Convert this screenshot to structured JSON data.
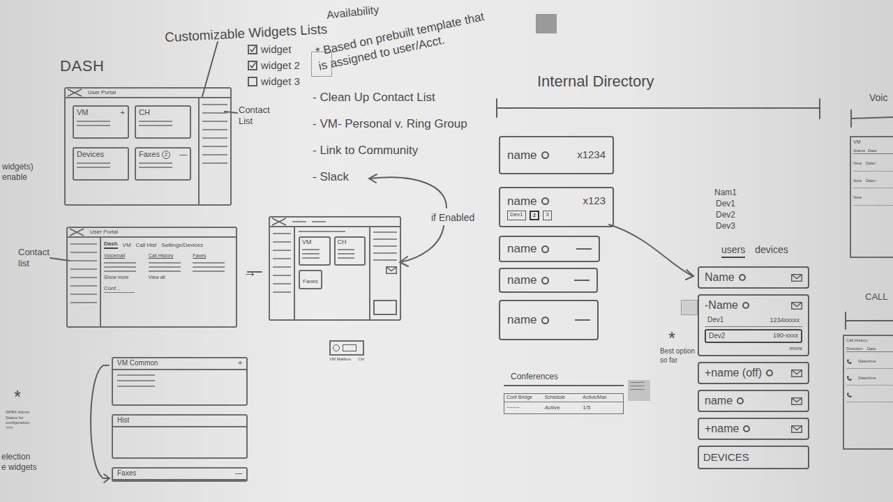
{
  "dash": {
    "title": "DASH",
    "contact_list_label": "Contact List",
    "edge_note": [
      "widgets)",
      "enable"
    ]
  },
  "widget_lists": {
    "title": "Customizable Widgets Lists",
    "items": [
      {
        "label": "widget",
        "checked": true
      },
      {
        "label": "widget 2",
        "checked": true
      },
      {
        "label": "widget 3",
        "checked": false
      }
    ]
  },
  "availability": {
    "title": "Availability",
    "note": "* Based on prebuilt template that is assigned to user/Acct."
  },
  "wireframe_1": {
    "title": "User Portal",
    "widgets": [
      {
        "label": "VM",
        "action": "+"
      },
      {
        "label": "CH"
      },
      {
        "label": "Devices"
      },
      {
        "label": "Faxes",
        "badge": "2",
        "action": "—"
      }
    ]
  },
  "todo": {
    "items": [
      "- Clean Up Contact List",
      "- VM- Personal v. Ring Group",
      "- Link to Community",
      "- Slack"
    ],
    "condition": "if Enabled"
  },
  "wireframe_2": {
    "title": "User Portal",
    "side_label": "Contact list",
    "tabs": [
      {
        "label": "Dash",
        "selected": true
      },
      {
        "label": "VM",
        "selected": false
      },
      {
        "label": "Call Hist",
        "selected": false
      },
      {
        "label": "Settings/Devices",
        "selected": false
      }
    ],
    "columns": [
      {
        "title": "Voicemail",
        "link": "Show more"
      },
      {
        "title": "Call History",
        "link": "View all"
      },
      {
        "title": "Faxes"
      }
    ],
    "footer": "Conf..."
  },
  "arrow": "→",
  "wireframe_3": {
    "widgets": [
      "VM",
      "CH"
    ],
    "footer": "Faxes"
  },
  "mini_widget": {
    "labels": [
      "VM Mailbox",
      "CH"
    ]
  },
  "wireframe_4": {
    "panels": [
      {
        "title": "VM Common",
        "action": "+"
      },
      {
        "title": "Hist"
      },
      {
        "title": "Faxes",
        "action": "—"
      }
    ]
  },
  "side_notes": {
    "star": "*",
    "note": "SPBX Admin Status for configuration ???",
    "caption": [
      "election",
      "e widgets"
    ]
  },
  "directory": {
    "title": "Internal Directory",
    "entries": [
      {
        "name": "name",
        "ext": "x1234",
        "devices": []
      },
      {
        "name": "name",
        "ext": "x123",
        "devices": [
          {
            "label": "Dev1",
            "selected": false
          },
          {
            "label": "2",
            "selected": true
          },
          {
            "label": "3",
            "selected": false
          }
        ]
      },
      {
        "name": "name",
        "devices": []
      },
      {
        "name": "name",
        "devices": []
      },
      {
        "name": "name",
        "devices": []
      }
    ],
    "conferences": {
      "title": "Conferences",
      "columns": [
        "Conf Bridge",
        "Schedule",
        "Active/Max"
      ],
      "rows": [
        {
          "bridge": "~~~~",
          "schedule": "Active",
          "count": "1/5"
        }
      ]
    }
  },
  "directory_panel": {
    "summary": [
      "Nam1",
      "Dev1",
      "Dev2",
      "Dev3"
    ],
    "tabs": [
      {
        "label": "users",
        "selected": true
      },
      {
        "label": "devices",
        "selected": false
      }
    ],
    "users": [
      {
        "name": "Name",
        "expanded": false
      },
      {
        "name": "-Name",
        "expanded": true,
        "devices": [
          {
            "label": "Dev1",
            "number": "1234xxxxx",
            "selected": false
          },
          {
            "label": "Dev2",
            "number": "190-xxxx",
            "selected": true
          }
        ],
        "more": "more"
      },
      {
        "name": "+name (off)",
        "expanded": false
      },
      {
        "name": "name",
        "expanded": false
      },
      {
        "name": "+name",
        "expanded": false
      }
    ],
    "devices_title": "DEVICES",
    "star": "*",
    "best_option": "Best option so far"
  },
  "right_edge": {
    "voicemail": {
      "title": "Voic",
      "tab": "VM",
      "columns": [
        "Status",
        "Date"
      ],
      "rows": [
        {
          "status": "New",
          "date": "Date/"
        },
        {
          "status": "New",
          "date": "Date/"
        },
        {
          "status": "New"
        }
      ]
    },
    "call_history": {
      "title": "CALL",
      "subtitle": "Call History",
      "columns": [
        "Direction",
        "Date"
      ],
      "rows": [
        {
          "date": "Date/time"
        },
        {
          "date": "Date/time"
        },
        {}
      ]
    }
  }
}
